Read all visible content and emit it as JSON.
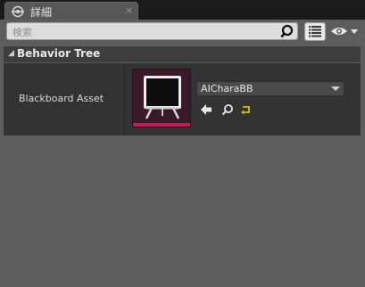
{
  "tab": {
    "title": "詳細",
    "close": "×"
  },
  "toolbar": {
    "search_placeholder": "検索"
  },
  "category": {
    "label": "Behavior Tree"
  },
  "property": {
    "label": "Blackboard Asset",
    "value": "AICharaBB"
  },
  "colors": {
    "accent": "#c41c5c",
    "panel": "#5d5d5d",
    "row": "#333333"
  },
  "icons": {
    "tab": "details-icon",
    "search": "search-icon",
    "list": "list-view-icon",
    "eye": "eye-icon",
    "use": "use-selected-arrow-icon",
    "browse": "browse-magnifier-icon",
    "reset": "reset-to-default-icon"
  }
}
